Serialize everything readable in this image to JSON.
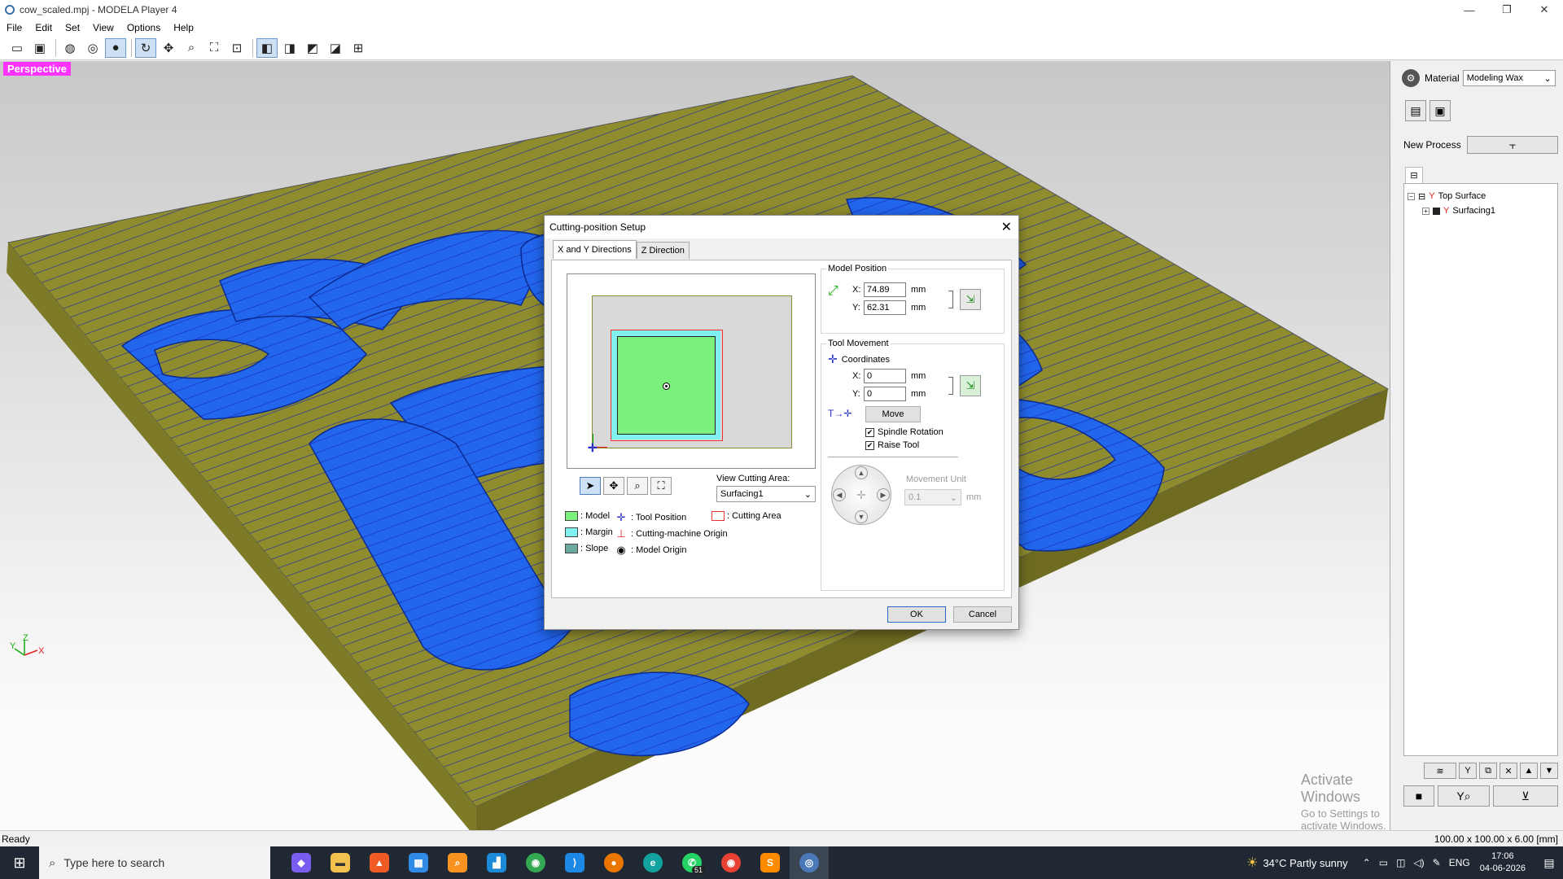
{
  "window": {
    "title": "cow_scaled.mpj - MODELA Player 4",
    "minimize": "—",
    "maximize": "❐",
    "close": "✕"
  },
  "menu": [
    "File",
    "Edit",
    "Set",
    "View",
    "Options",
    "Help"
  ],
  "toolbar_icons": [
    "open-icon",
    "save-icon",
    "wireframe-icon",
    "globe-icon",
    "shaded-icon",
    "rotate-icon",
    "pan-icon",
    "zoom-icon",
    "fit-icon",
    "zoom-box-icon",
    "view-iso-icon",
    "view-front-icon",
    "view-side-icon",
    "view-top-icon",
    "view-multi-icon"
  ],
  "viewport": {
    "label": "Perspective",
    "axes": {
      "x": "X",
      "y": "Y",
      "z": "Z"
    },
    "colors": {
      "base": "#8f8c2e",
      "model": "#2266ee",
      "toolpath": "#1a2aa8",
      "label_bg": "#ff33ff"
    },
    "watermark_line1": "Activate Windows",
    "watermark_line2": "Go to Settings to activate Windows."
  },
  "right_panel": {
    "material_label": "Material",
    "material_value": "Modeling Wax",
    "new_process_label": "New Process",
    "tree": [
      {
        "label": "Top Surface",
        "level": 0
      },
      {
        "label": "Surfacing1",
        "level": 1
      }
    ]
  },
  "status": {
    "left": "Ready",
    "right": "100.00 x 100.00 x 6.00 [mm]"
  },
  "dialog": {
    "title": "Cutting-position Setup",
    "tabs": [
      "X and Y Directions",
      "Z Direction"
    ],
    "view_cutting_area_label": "View Cutting Area:",
    "view_cutting_area_value": "Surfacing1",
    "legend": {
      "model": ": Model",
      "margin": ": Margin",
      "slope": ": Slope",
      "tool_position": ": Tool Position",
      "machine_origin": ": Cutting-machine Origin",
      "model_origin": ": Model Origin",
      "cutting_area": ": Cutting Area"
    },
    "model_position": {
      "title": "Model Position",
      "x_label": "X:",
      "y_label": "Y:",
      "x": "74.89",
      "y": "62.31",
      "unit": "mm"
    },
    "tool_movement": {
      "title": "Tool Movement",
      "coordinates_label": "Coordinates",
      "x_label": "X:",
      "y_label": "Y:",
      "x": "0",
      "y": "0",
      "unit": "mm",
      "move_label": "Move",
      "spindle_label": "Spindle Rotation",
      "raise_label": "Raise Tool",
      "movement_unit_label": "Movement Unit",
      "movement_unit_value": "0.1",
      "movement_unit_unit": "mm"
    },
    "ok": "OK",
    "cancel": "Cancel",
    "colors": {
      "model": "#7cf07c",
      "margin": "#80f0f0",
      "slope": "#6aa8a0",
      "cutting_area": "#e33333"
    }
  },
  "taskbar": {
    "search_placeholder": "Type here to search",
    "whatsapp_badge": "51",
    "weather": "34°C  Partly sunny",
    "language": "ENG",
    "time": "17:06",
    "date": "04-06-2026"
  }
}
